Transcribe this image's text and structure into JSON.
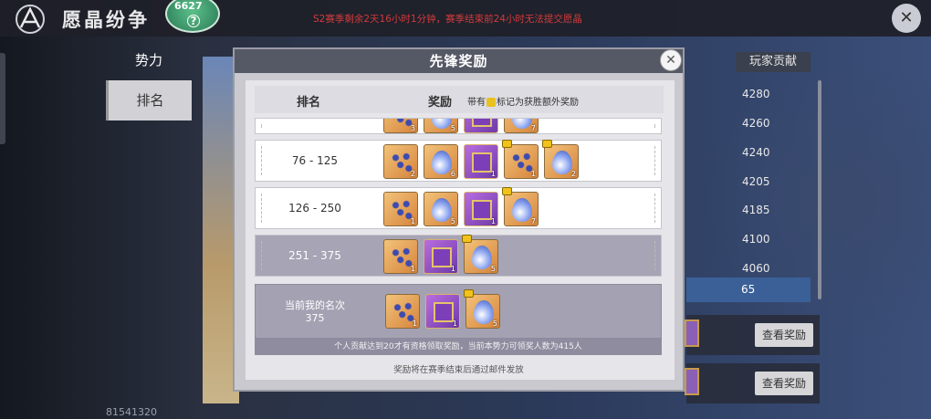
{
  "header": {
    "title": "愿晶纷争",
    "badge_value": "6627",
    "badge_icon": "?",
    "notice": "S2赛季剩余2天16小时1分钟，赛季结束前24小时无法提交愿晶"
  },
  "side_tabs": [
    {
      "label": "势力"
    },
    {
      "label": "排名"
    }
  ],
  "bottom_number": "81541320",
  "right_column": {
    "header": "玩家贡献",
    "values": [
      "4280",
      "4260",
      "4240",
      "4205",
      "4185",
      "4100",
      "4060"
    ],
    "selected_value": "65",
    "buttons": [
      {
        "label": "查看奖励"
      },
      {
        "label": "查看奖励"
      }
    ]
  },
  "modal": {
    "title": "先锋奖励",
    "col_rank": "排名",
    "col_reward": "奖励",
    "col_note_prefix": "带有",
    "col_note_suffix": "标记为获胜额外奖励",
    "rows": [
      {
        "rank": "",
        "items": [
          {
            "type": "dots",
            "count": "3"
          },
          {
            "type": "gem",
            "count": "5"
          },
          {
            "type": "box",
            "count": ""
          },
          {
            "type": "gem",
            "count": "7"
          }
        ]
      },
      {
        "rank": "76 - 125",
        "items": [
          {
            "type": "dots",
            "count": "2"
          },
          {
            "type": "gem",
            "count": "6"
          },
          {
            "type": "box",
            "count": "1"
          },
          {
            "type": "dots",
            "count": "1",
            "bonus": true
          },
          {
            "type": "gem",
            "count": "2",
            "bonus": true
          }
        ]
      },
      {
        "rank": "126 - 250",
        "items": [
          {
            "type": "dots",
            "count": "1"
          },
          {
            "type": "gem",
            "count": "5"
          },
          {
            "type": "box",
            "count": "1"
          },
          {
            "type": "gem",
            "count": "7",
            "bonus": true
          }
        ]
      },
      {
        "rank": "251 - 375",
        "items": [
          {
            "type": "dots",
            "count": "1"
          },
          {
            "type": "box",
            "count": "1"
          },
          {
            "type": "gem",
            "count": "5",
            "bonus": true
          }
        ]
      }
    ],
    "mine_label_line1": "当前我的名次",
    "mine_label_line2": "375",
    "mine_items": [
      {
        "type": "dots",
        "count": "1"
      },
      {
        "type": "box",
        "count": "1"
      },
      {
        "type": "gem",
        "count": "5",
        "bonus": true
      }
    ],
    "mine_note": "个人贡献达到20才有资格领取奖励，当前本势力可领奖人数为415人",
    "footer_note": "奖励将在赛季结束后通过邮件发放"
  },
  "colors": {
    "accent_gold": "#f1c21b",
    "selected_row": "#3b6098",
    "notice_red": "#d23b3b"
  }
}
